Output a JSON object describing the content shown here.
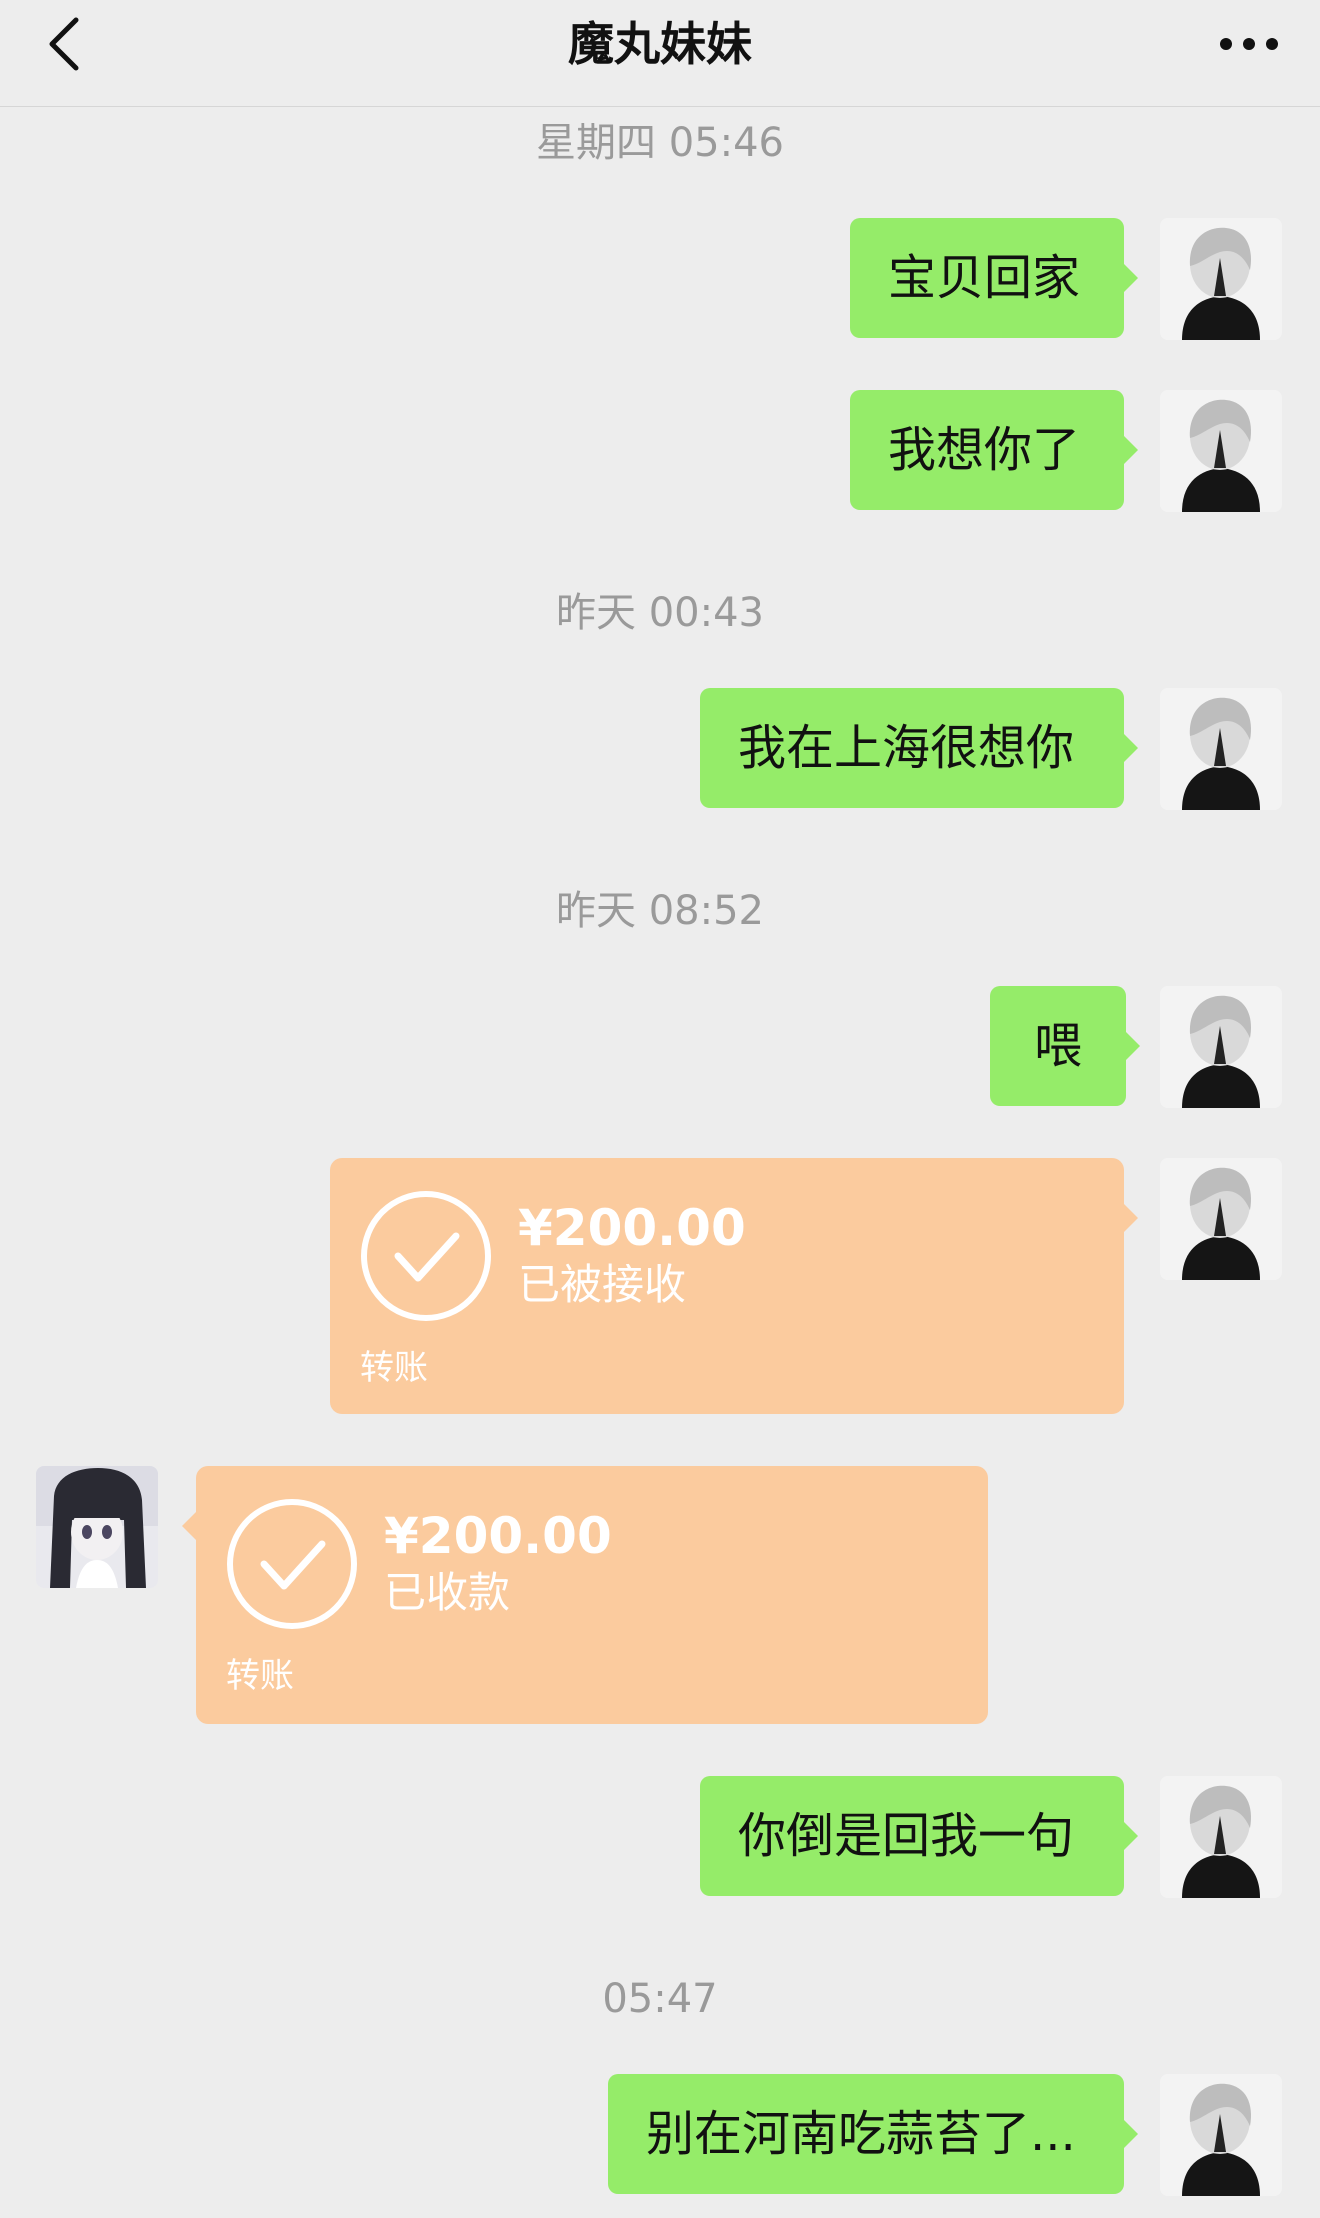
{
  "header": {
    "title": "魔丸妹妹",
    "back_icon": "chevron-left-icon",
    "more_icon": "more-dots-icon"
  },
  "timestamps": [
    "星期四 05:46",
    "昨天 00:43",
    "昨天 08:52",
    "05:47"
  ],
  "messages": [
    {
      "text": "宝贝回家"
    },
    {
      "text": "我想你了"
    },
    {
      "text": "我在上海很想你"
    },
    {
      "text": "喂"
    },
    {
      "text": "你倒是回我一句"
    },
    {
      "text": "别在河南吃蒜苔了..."
    }
  ],
  "transfers": [
    {
      "amount": "¥200.00",
      "status": "已被接收",
      "label": "转账"
    },
    {
      "amount": "¥200.00",
      "status": "已收款",
      "label": "转账"
    }
  ],
  "colors": {
    "background": "#ededed",
    "bubble_green": "#95ec69",
    "transfer_orange": "#fbcb9e",
    "time_gray": "#9a9a9a"
  }
}
